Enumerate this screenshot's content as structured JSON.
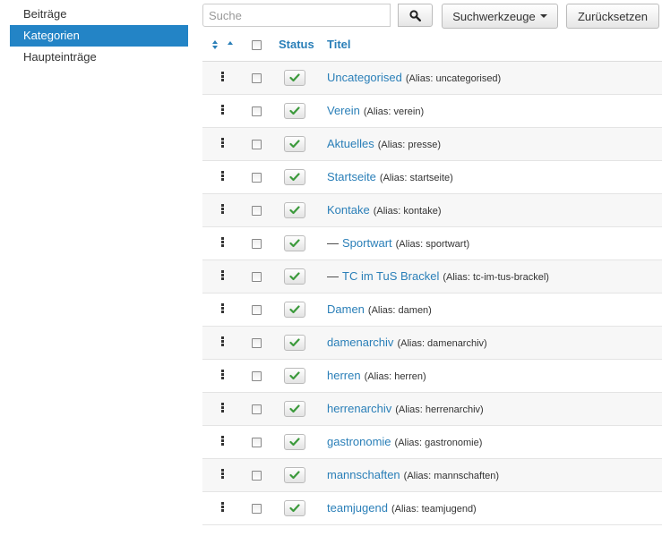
{
  "sidebar": {
    "items": [
      {
        "label": "Beiträge"
      },
      {
        "label": "Kategorien"
      },
      {
        "label": "Haupteinträge"
      }
    ]
  },
  "toolbar": {
    "search_placeholder": "Suche",
    "tools_label": "Suchwerkzeuge",
    "reset_label": "Zurücksetzen"
  },
  "table": {
    "headers": {
      "status": "Status",
      "title": "Titel"
    },
    "rows": [
      {
        "title": "Uncategorised",
        "alias": "(Alias: uncategorised)",
        "prefix": ""
      },
      {
        "title": "Verein",
        "alias": "(Alias: verein)",
        "prefix": ""
      },
      {
        "title": "Aktuelles",
        "alias": "(Alias: presse)",
        "prefix": ""
      },
      {
        "title": "Startseite",
        "alias": "(Alias: startseite)",
        "prefix": ""
      },
      {
        "title": "Kontake",
        "alias": "(Alias: kontake)",
        "prefix": ""
      },
      {
        "title": "Sportwart",
        "alias": "(Alias: sportwart)",
        "prefix": "—"
      },
      {
        "title": "TC im TuS Brackel",
        "alias": "(Alias: tc-im-tus-brackel)",
        "prefix": "—"
      },
      {
        "title": "Damen",
        "alias": "(Alias: damen)",
        "prefix": ""
      },
      {
        "title": "damenarchiv",
        "alias": "(Alias: damenarchiv)",
        "prefix": ""
      },
      {
        "title": "herren",
        "alias": "(Alias: herren)",
        "prefix": ""
      },
      {
        "title": "herrenarchiv",
        "alias": "(Alias: herrenarchiv)",
        "prefix": ""
      },
      {
        "title": "gastronomie",
        "alias": "(Alias: gastronomie)",
        "prefix": ""
      },
      {
        "title": "mannschaften",
        "alias": "(Alias: mannschaften)",
        "prefix": ""
      },
      {
        "title": "teamjugend",
        "alias": "(Alias: teamjugend)",
        "prefix": ""
      }
    ]
  },
  "colors": {
    "accent": "#2384c6",
    "link": "#2a7fb8",
    "published": "#3c9a3c"
  }
}
